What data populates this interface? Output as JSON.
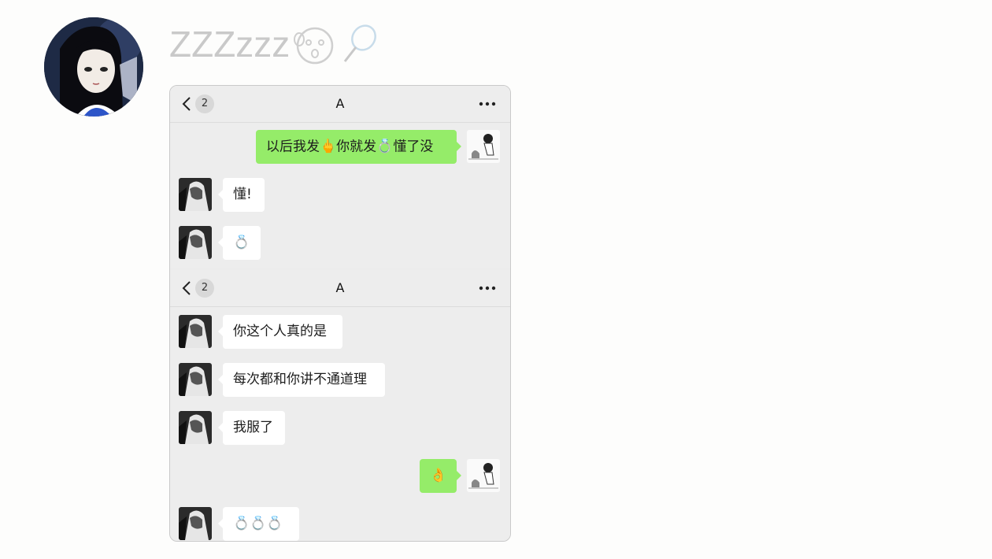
{
  "post": {
    "author_name": "ZZZzzz",
    "author_avatar_icon": "anime-girl-avatar-icon",
    "name_emoji_icons": [
      "sleep-face-icon",
      "badminton-racket-icon"
    ]
  },
  "chat_screens": [
    {
      "header": {
        "unread_count": "2",
        "title": "A",
        "back_icon": "chevron-left-icon",
        "more_icon": "more-dots-icon"
      },
      "messages": [
        {
          "direction": "out",
          "parts": [
            "以后我发",
            "🖕",
            "你就发",
            "💍",
            "懂了没"
          ]
        },
        {
          "direction": "in",
          "text": "懂!"
        },
        {
          "direction": "in",
          "emoji": "💍"
        }
      ]
    },
    {
      "header": {
        "unread_count": "2",
        "title": "A",
        "back_icon": "chevron-left-icon",
        "more_icon": "more-dots-icon"
      },
      "messages": [
        {
          "direction": "in",
          "text": "你这个人真的是"
        },
        {
          "direction": "in",
          "text": "每次都和你讲不通道理"
        },
        {
          "direction": "in",
          "text": "我服了"
        },
        {
          "direction": "out",
          "emoji": "👌"
        },
        {
          "direction": "in",
          "emoji": "💍💍💍"
        }
      ]
    }
  ],
  "colors": {
    "outgoing_bubble": "#95ec69",
    "incoming_bubble": "#ffffff",
    "chat_background": "#ededed",
    "author_name": "#c9c9c9"
  }
}
